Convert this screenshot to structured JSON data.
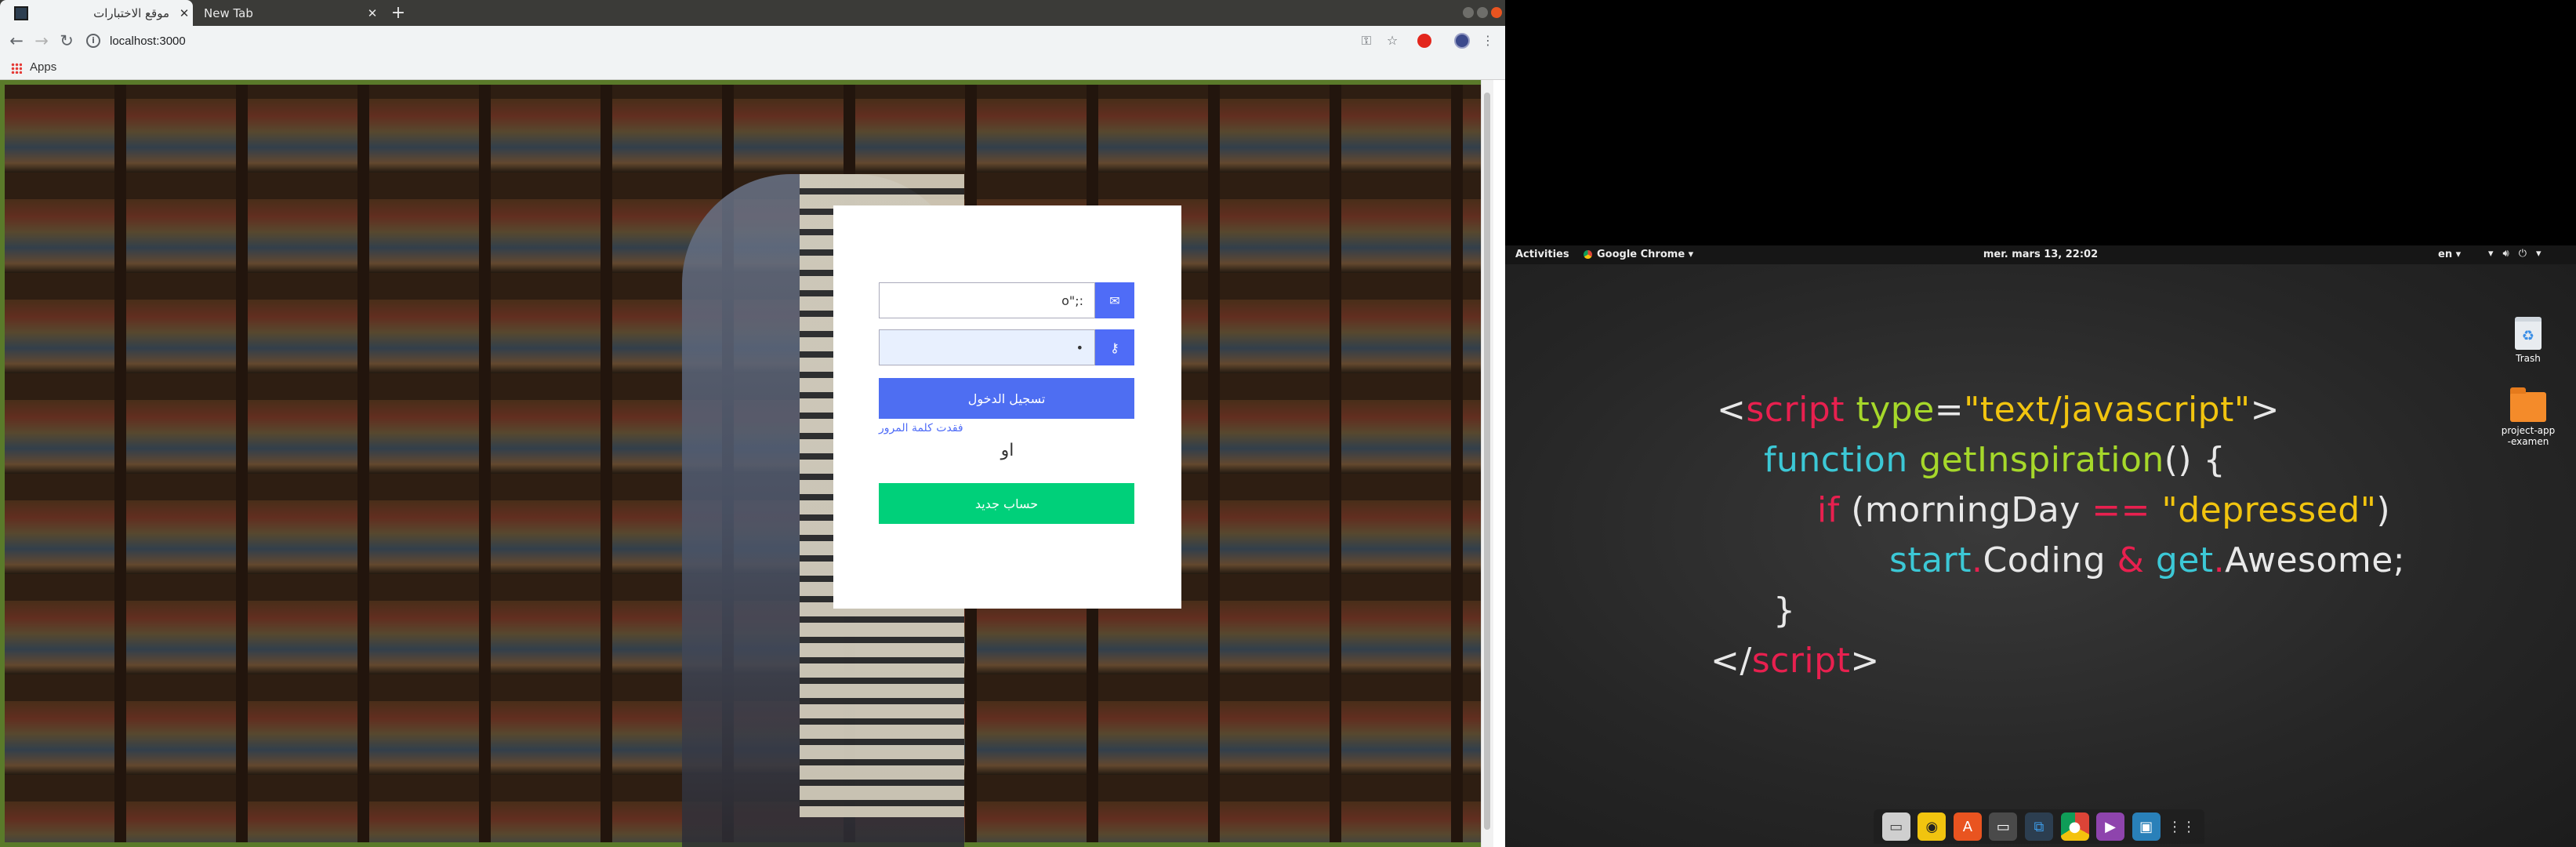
{
  "chrome": {
    "tabs": [
      {
        "title": "موقع الاختبارات",
        "active": true
      },
      {
        "title": "New Tab",
        "active": false
      }
    ],
    "url": "localhost:3000",
    "bookmarks": {
      "apps_label": "Apps"
    }
  },
  "login_card": {
    "email_value": "o\";:",
    "password_value": "•",
    "login_button": "تسجيل الدخول",
    "forgot_password": "فقدت كلمة المرور",
    "or_text": "او",
    "signup_button": "حساب جديد"
  },
  "desktop": {
    "topbar": {
      "activities": "Activities",
      "app_name": "Google Chrome",
      "clock": "mer. mars 13, 22:02",
      "lang": "en"
    },
    "icons": [
      {
        "label": "Trash"
      },
      {
        "label": "project-app-examen"
      }
    ],
    "wallpaper_code": {
      "line1_open": "<",
      "line1_tag": "script",
      "line1_attr": " type",
      "line1_eq": "=",
      "line1_val": "\"text/javascript\"",
      "line1_close": ">",
      "line2_kw": "function",
      "line2_fn": " getInspiration",
      "line2_rest": "() {",
      "line3_kw": "if",
      "line3_open": " (morningDay ",
      "line3_op": "==",
      "line3_str": " \"depressed\"",
      "line3_close": ")",
      "line4_a": "start",
      "line4_dot1": ".",
      "line4_b": "Coding ",
      "line4_amp": "&",
      "line4_c": " get",
      "line4_dot2": ".",
      "line4_d": "Awesome;",
      "line5": "}",
      "line6_open": "</",
      "line6_tag": "script",
      "line6_close": ">"
    }
  },
  "colors": {
    "accent_blue": "#4e6ef2",
    "signup_green": "#00d07a"
  }
}
